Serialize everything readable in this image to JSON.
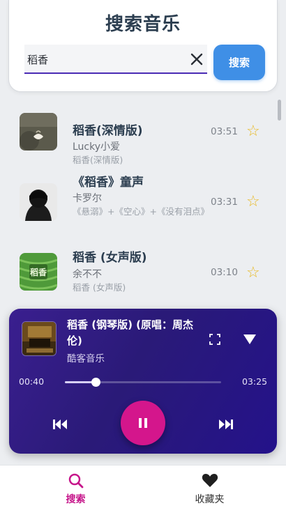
{
  "search": {
    "title": "搜索音乐",
    "query": "稻香",
    "button_label": "搜索"
  },
  "results": [
    {
      "title": "稻香(深情版)",
      "artist": "Lucky小爱",
      "album": "稻香(深情版)",
      "duration": "03:51",
      "favorite_icon": "star-outline-icon"
    },
    {
      "title": "《稻香》童声",
      "artist": "卡罗尔",
      "album": "《悬溺》+《空心》+《没有泪点》",
      "duration": "03:31",
      "favorite_icon": "star-outline-icon"
    },
    {
      "title": "稻香 (女声版)",
      "artist": "余不不",
      "album": "稻香 (女声版)",
      "duration": "03:10",
      "favorite_icon": "star-outline-icon"
    }
  ],
  "player": {
    "title": "稻香 (钢琴版) (原唱：周杰伦)",
    "artist": "酷客音乐",
    "current_time": "00:40",
    "total_time": "03:25",
    "progress": 0.195,
    "state": "playing"
  },
  "nav": {
    "items": [
      {
        "label": "搜索",
        "icon": "search-icon",
        "active": true
      },
      {
        "label": "收藏夹",
        "icon": "heart-icon",
        "active": false
      }
    ]
  },
  "colors": {
    "accent_blue": "#3f8fe6",
    "search_underline": "#4a2bb5",
    "player_bg": "#2a1a78",
    "play_button": "#d4168c",
    "star": "#e8b923",
    "nav_active": "#c6158a"
  }
}
